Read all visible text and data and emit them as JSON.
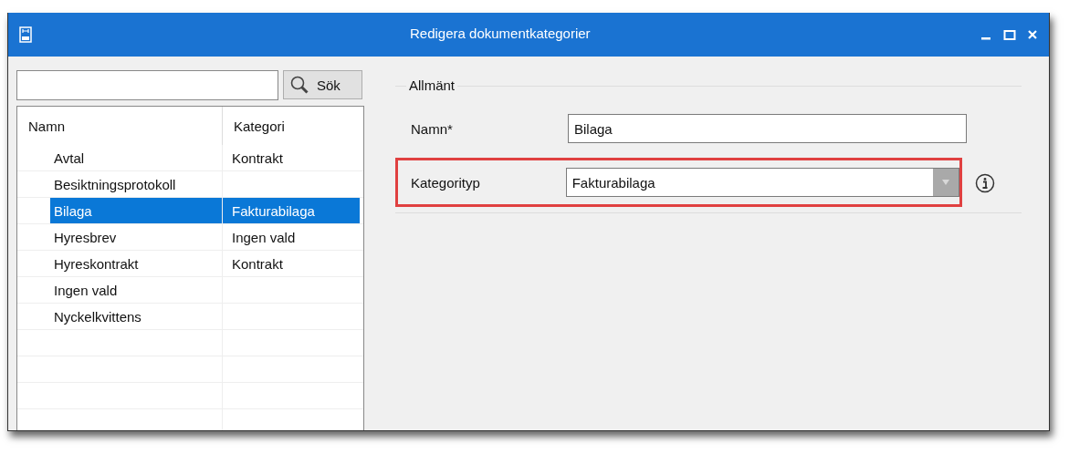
{
  "window": {
    "title": "Redigera dokumentkategorier"
  },
  "search": {
    "button": "Sök"
  },
  "table": {
    "columns": [
      "Namn",
      "Kategori"
    ],
    "rows": [
      {
        "name": "Avtal",
        "category": "Kontrakt",
        "selected": false
      },
      {
        "name": "Besiktningsprotokoll",
        "category": "",
        "selected": false
      },
      {
        "name": "Bilaga",
        "category": "Fakturabilaga",
        "selected": true
      },
      {
        "name": "Hyresbrev",
        "category": "Ingen vald",
        "selected": false
      },
      {
        "name": "Hyreskontrakt",
        "category": "Kontrakt",
        "selected": false
      },
      {
        "name": "Ingen vald",
        "category": "",
        "selected": false
      },
      {
        "name": "Nyckelkvittens",
        "category": "",
        "selected": false
      }
    ]
  },
  "group": {
    "title": "Allmänt",
    "fields": [
      {
        "kind": "text",
        "label": "Namn*",
        "value": "Bilaga",
        "highlighted": false
      },
      {
        "kind": "dropdown",
        "label": "Kategorityp",
        "value": "Fakturabilaga",
        "highlighted": true
      }
    ]
  }
}
